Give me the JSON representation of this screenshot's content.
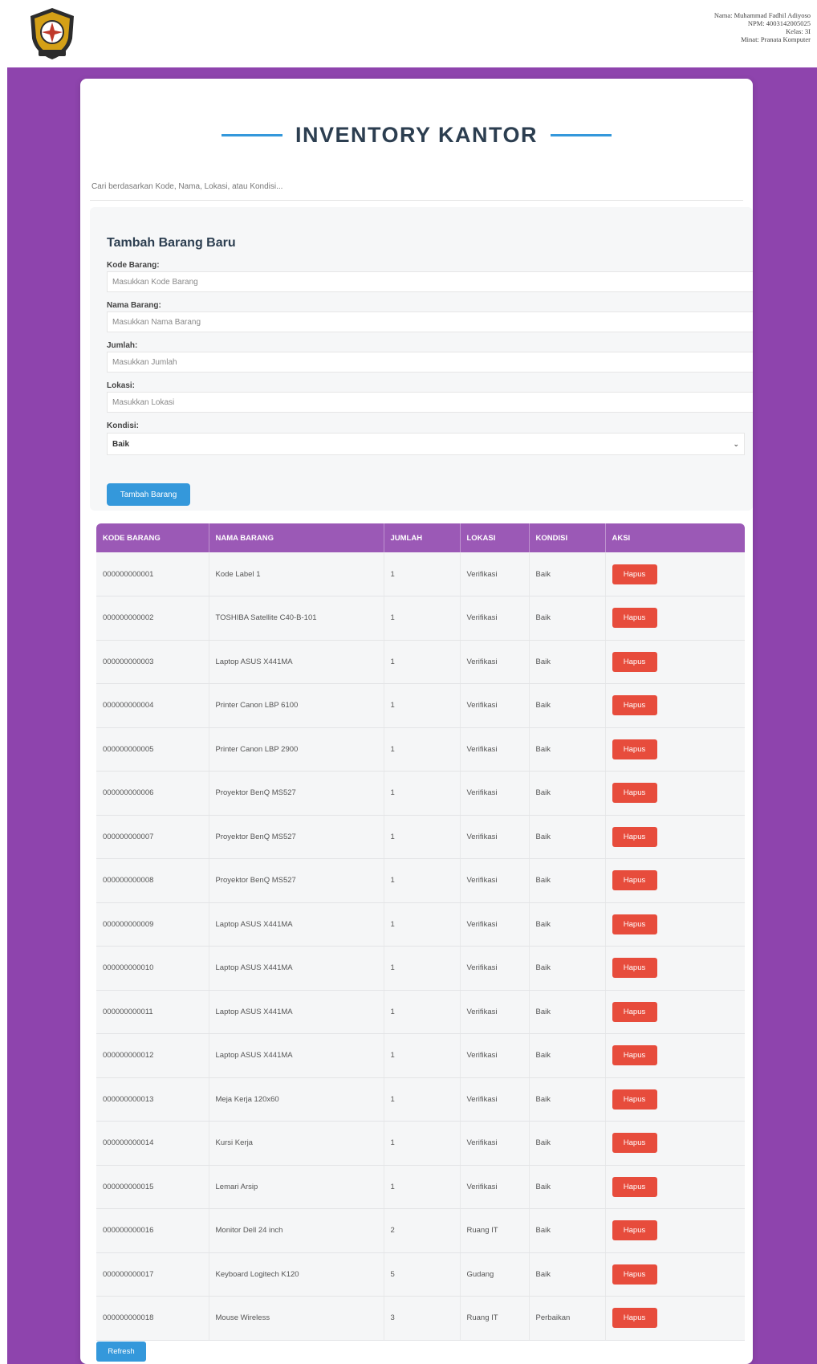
{
  "header": {
    "user_info": [
      "Nama: Muhammad Fadhil Adiyoso",
      "NPM: 4003142005025",
      "Kelas: 3I",
      "Minat: Pranata Komputer"
    ]
  },
  "page": {
    "title": "INVENTORY KANTOR"
  },
  "search": {
    "placeholder": "Cari berdasarkan Kode, Nama, Lokasi, atau Kondisi..."
  },
  "form": {
    "title": "Tambah Barang Baru",
    "kode_label": "Kode Barang:",
    "kode_placeholder": "Masukkan Kode Barang",
    "nama_label": "Nama Barang:",
    "nama_placeholder": "Masukkan Nama Barang",
    "jumlah_label": "Jumlah:",
    "jumlah_placeholder": "Masukkan Jumlah",
    "lokasi_label": "Lokasi:",
    "lokasi_placeholder": "Masukkan Lokasi",
    "kondisi_label": "Kondisi:",
    "kondisi_value": "Baik",
    "submit_label": "Tambah Barang"
  },
  "table": {
    "columns": [
      "KODE BARANG",
      "NAMA BARANG",
      "JUMLAH",
      "LOKASI",
      "KONDISI",
      "AKSI"
    ],
    "delete_label": "Hapus",
    "rows": [
      [
        "000000000001",
        "Kode Label 1",
        "1",
        "Verifikasi",
        "Baik"
      ],
      [
        "000000000002",
        "TOSHIBA Satellite C40-B-101",
        "1",
        "Verifikasi",
        "Baik"
      ],
      [
        "000000000003",
        "Laptop ASUS X441MA",
        "1",
        "Verifikasi",
        "Baik"
      ],
      [
        "000000000004",
        "Printer Canon LBP 6100",
        "1",
        "Verifikasi",
        "Baik"
      ],
      [
        "000000000005",
        "Printer Canon LBP 2900",
        "1",
        "Verifikasi",
        "Baik"
      ],
      [
        "000000000006",
        "Proyektor BenQ MS527",
        "1",
        "Verifikasi",
        "Baik"
      ],
      [
        "000000000007",
        "Proyektor BenQ MS527",
        "1",
        "Verifikasi",
        "Baik"
      ],
      [
        "000000000008",
        "Proyektor BenQ MS527",
        "1",
        "Verifikasi",
        "Baik"
      ],
      [
        "000000000009",
        "Laptop ASUS X441MA",
        "1",
        "Verifikasi",
        "Baik"
      ],
      [
        "000000000010",
        "Laptop ASUS X441MA",
        "1",
        "Verifikasi",
        "Baik"
      ],
      [
        "000000000011",
        "Laptop ASUS X441MA",
        "1",
        "Verifikasi",
        "Baik"
      ],
      [
        "000000000012",
        "Laptop ASUS X441MA",
        "1",
        "Verifikasi",
        "Baik"
      ],
      [
        "000000000013",
        "Meja Kerja 120x60",
        "1",
        "Verifikasi",
        "Baik"
      ],
      [
        "000000000014",
        "Kursi Kerja",
        "1",
        "Verifikasi",
        "Baik"
      ],
      [
        "000000000015",
        "Lemari Arsip",
        "1",
        "Verifikasi",
        "Baik"
      ],
      [
        "000000000016",
        "Monitor Dell 24 inch",
        "2",
        "Ruang IT",
        "Baik"
      ],
      [
        "000000000017",
        "Keyboard Logitech K120",
        "5",
        "Gudang",
        "Baik"
      ],
      [
        "000000000018",
        "Mouse Wireless",
        "3",
        "Ruang IT",
        "Perbaikan"
      ]
    ]
  },
  "footer": {
    "refresh_label": "Refresh"
  },
  "colors": {
    "brand_purple": "#8e44ad",
    "table_header": "#9b59b6",
    "primary_blue": "#3498db",
    "danger_red": "#e74c3c"
  }
}
